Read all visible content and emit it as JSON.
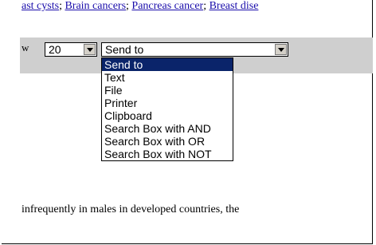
{
  "links": [
    {
      "text": "ast cysts"
    },
    {
      "text": "Brain cancers"
    },
    {
      "text": "Pancreas cancer"
    },
    {
      "text": "Breast dise"
    }
  ],
  "separator": "; ",
  "toolbar": {
    "w_label": "w",
    "count_value": "20",
    "send_value": "Send to"
  },
  "dropdown": {
    "options": [
      "Send to",
      "Text",
      "File",
      "Printer",
      "Clipboard",
      "Search Box with AND",
      "Search Box with OR",
      "Search Box with NOT"
    ],
    "selected_index": 0
  },
  "body_text": "infrequently in males in developed countries, the"
}
